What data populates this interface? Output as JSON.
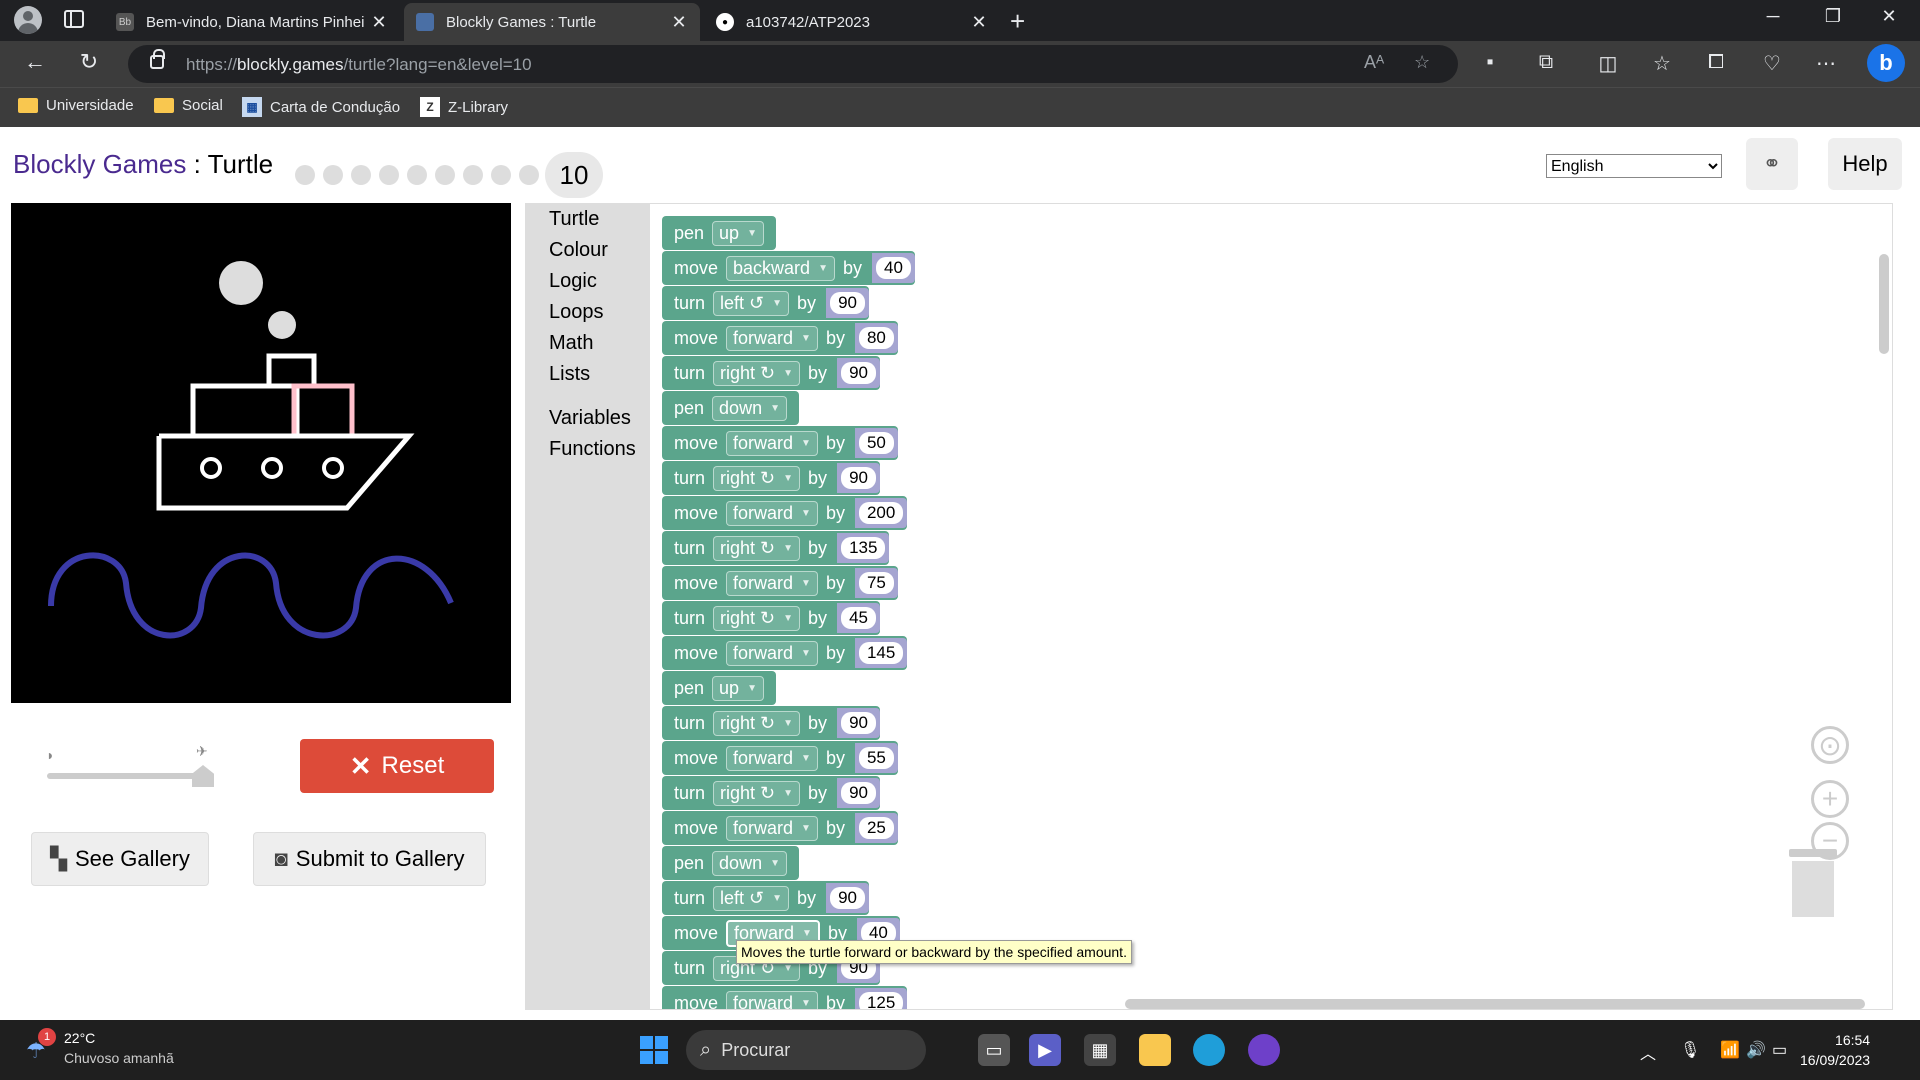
{
  "browser": {
    "tabs": [
      {
        "title": "Bem-vindo, Diana Martins Pinhei",
        "active": false
      },
      {
        "title": "Blockly Games : Turtle",
        "active": true
      },
      {
        "title": "a103742/ATP2023",
        "active": false
      }
    ],
    "url_prefix": "https://",
    "url_host": "blockly.games",
    "url_path": "/turtle?lang=en&level=10",
    "bookmarks": [
      {
        "label": "Universidade",
        "icon": "folder-icon"
      },
      {
        "label": "Social",
        "icon": "folder-icon"
      },
      {
        "label": "Carta de Condução",
        "icon": "site-icon"
      },
      {
        "label": "Z-Library",
        "icon": "zlibrary-icon"
      }
    ]
  },
  "header": {
    "brand": "Blockly Games",
    "separator": " : ",
    "game": "Turtle",
    "current_level": "10",
    "level_dots": 9,
    "language": "English",
    "help_label": "Help"
  },
  "controls": {
    "reset_label": "Reset",
    "see_gallery_label": "See Gallery",
    "submit_gallery_label": "Submit to Gallery",
    "speed_level": 1.0
  },
  "toolbox": {
    "categories": [
      "Turtle",
      "Colour",
      "Logic",
      "Loops",
      "Math",
      "Lists"
    ],
    "custom": [
      "Variables",
      "Functions"
    ]
  },
  "blocks": [
    {
      "kind": "pen",
      "label": "pen",
      "option": "up"
    },
    {
      "kind": "move",
      "label": "move",
      "option": "backward",
      "by": "by",
      "value": "40"
    },
    {
      "kind": "turn",
      "label": "turn",
      "option": "left ↺",
      "by": "by",
      "value": "90"
    },
    {
      "kind": "move",
      "label": "move",
      "option": "forward",
      "by": "by",
      "value": "80"
    },
    {
      "kind": "turn",
      "label": "turn",
      "option": "right ↻",
      "by": "by",
      "value": "90"
    },
    {
      "kind": "pen",
      "label": "pen",
      "option": "down"
    },
    {
      "kind": "move",
      "label": "move",
      "option": "forward",
      "by": "by",
      "value": "50"
    },
    {
      "kind": "turn",
      "label": "turn",
      "option": "right ↻",
      "by": "by",
      "value": "90"
    },
    {
      "kind": "move",
      "label": "move",
      "option": "forward",
      "by": "by",
      "value": "200"
    },
    {
      "kind": "turn",
      "label": "turn",
      "option": "right ↻",
      "by": "by",
      "value": "135"
    },
    {
      "kind": "move",
      "label": "move",
      "option": "forward",
      "by": "by",
      "value": "75"
    },
    {
      "kind": "turn",
      "label": "turn",
      "option": "right ↻",
      "by": "by",
      "value": "45"
    },
    {
      "kind": "move",
      "label": "move",
      "option": "forward",
      "by": "by",
      "value": "145"
    },
    {
      "kind": "pen",
      "label": "pen",
      "option": "up"
    },
    {
      "kind": "turn",
      "label": "turn",
      "option": "right ↻",
      "by": "by",
      "value": "90"
    },
    {
      "kind": "move",
      "label": "move",
      "option": "forward",
      "by": "by",
      "value": "55"
    },
    {
      "kind": "turn",
      "label": "turn",
      "option": "right ↻",
      "by": "by",
      "value": "90"
    },
    {
      "kind": "move",
      "label": "move",
      "option": "forward",
      "by": "by",
      "value": "25"
    },
    {
      "kind": "pen",
      "label": "pen",
      "option": "down"
    },
    {
      "kind": "turn",
      "label": "turn",
      "option": "left ↺",
      "by": "by",
      "value": "90"
    },
    {
      "kind": "move",
      "label": "move",
      "option": "forward",
      "by": "by",
      "value": "40",
      "highlight": true
    },
    {
      "kind": "turn",
      "label": "turn",
      "option": "right ↻",
      "by": "by",
      "value": "90"
    },
    {
      "kind": "move",
      "label": "move",
      "option": "forward",
      "by": "by",
      "value": "125"
    }
  ],
  "tooltip": "Moves the turtle forward or backward by the specified amount.",
  "canvas_colors": {
    "ship": "#ffffff",
    "cabin": "#ffc0cb",
    "waves": "#3a3aa8",
    "smoke": "#dddddd",
    "background": "#000000"
  },
  "taskbar": {
    "weather_temp": "22°C",
    "weather_forecast": "Chuvoso amanhã",
    "weather_badge": "1",
    "search_label": "Procurar",
    "time": "16:54",
    "date": "16/09/2023"
  }
}
